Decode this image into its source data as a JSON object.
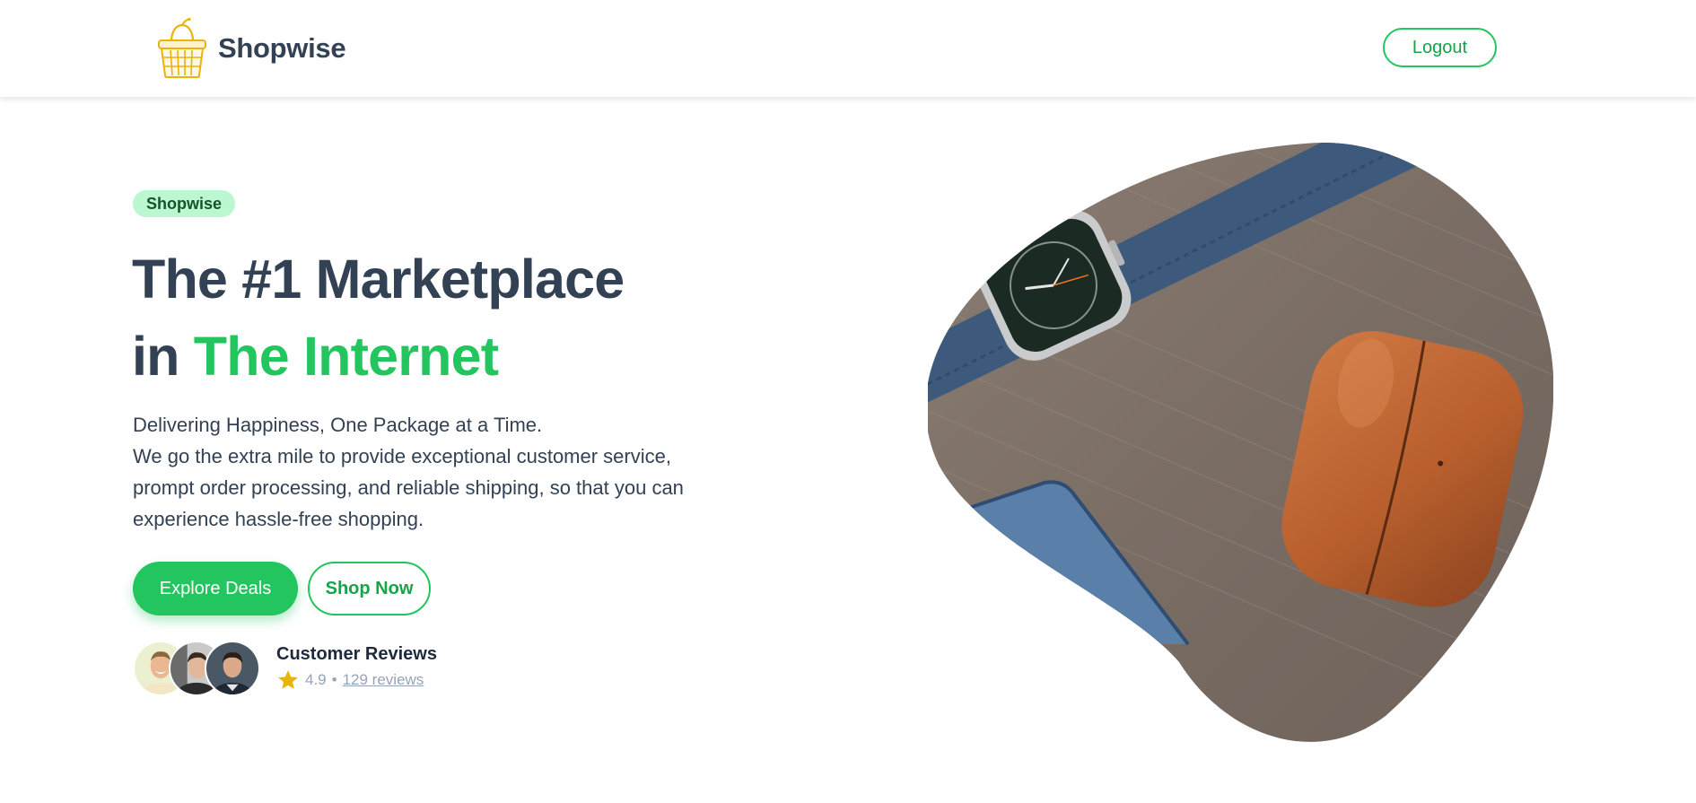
{
  "nav": {
    "brand": "Shopwise",
    "logo_icon": "shopping-basket-icon",
    "logout_label": "Logout"
  },
  "hero": {
    "badge": "Shopwise",
    "title_line1": "The #1 Marketplace",
    "title_line2_prefix": "in",
    "title_line2_accent": "The Internet",
    "description_lines": [
      "Delivering Happiness, One Package at a Time.",
      "We go the extra mile to provide exceptional customer service,",
      "prompt order processing, and reliable shipping, so that you can",
      "experience hassle-free shopping."
    ],
    "primary_cta": "Explore Deals",
    "secondary_cta": "Shop Now",
    "image_subject": "smartwatch-and-earbuds-case-photo"
  },
  "reviews": {
    "title": "Customer Reviews",
    "rating": "4.9",
    "separator": "•",
    "count_link": "129 reviews",
    "star_icon": "star-icon",
    "avatars": [
      "customer-avatar-1",
      "customer-avatar-2",
      "customer-avatar-3"
    ]
  },
  "colors": {
    "accent": "#22c55e",
    "accent_dark": "#16a34a",
    "badge_bg": "#bbf7d0",
    "text_dark": "#334155",
    "muted": "#94a3b8",
    "star": "#eab308"
  }
}
